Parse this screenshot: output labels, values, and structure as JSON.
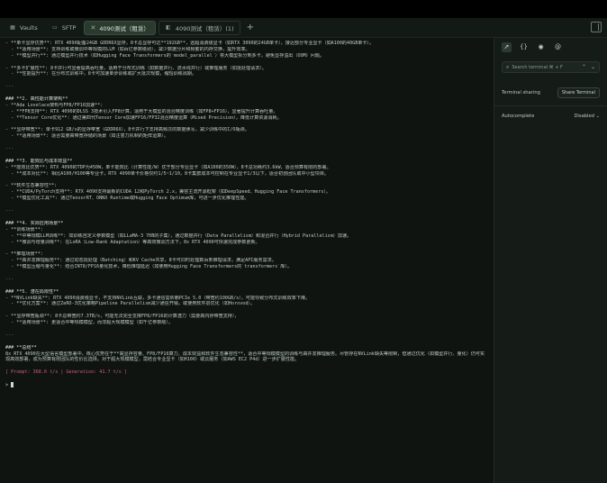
{
  "tabs": [
    {
      "label": "Vaults",
      "icon": "vault-icon"
    },
    {
      "label": "SFTP",
      "icon": "folder-icon"
    },
    {
      "label": "4090测试（租赁）",
      "icon": "close-icon",
      "active": true
    },
    {
      "label": "4090测试（租赁）(1)",
      "icon": "terminal-icon"
    }
  ],
  "terminal_lines": [
    "- **单卡显存优势**: RTX 4090配备24GB GDDR6X显存，8卡总显存可达**192GB**，远超消费级显卡（如RTX 3090的24GB单卡），接近部分专业显卡（如A100的40GB单卡）。",
    "  - **适用场景**: 支持训练或微调中等规模的LLM（如百亿参数级别），减少数据分片和频繁的内存交换，提升效率。",
    "  - **模型并行**: 通过模型并行技术（如Hugging Face Transformers的`model_parallel`）将大模型拆分到多卡，避免显存溢出（OOM）问题。",
    "",
    "- **多卡扩展性**: 8卡并行可显著提高吞吐量，适用于分布式训练（如数据并行、流水线并行）或推理服务（如批处理请求）。",
    "  - **性能提升**: 在分布式训练中，8卡可加速单步训练或扩大批次规模，缩短训练周期。",
    "",
    "---",
    "",
    "### **2. 高性能计算架构**",
    "- **Ada Lovelace架构与FP8/FP16加速**:",
    "  - **FP8支持**: RTX 4090的DLSS 3技术引入FP8计算，适用于大模型的混合精度训练（如FP8+FP16），显著提升计算吞吐量。",
    "  - **Tensor Core优化**: 通过第四代Tensor Core加速FP16/FP32混合精度运算（Mixed Precision），降低计算资源消耗。",
    "",
    "- **显存带宽**: 单卡912 GB/s的显存带宽（GDDR6X），8卡并行下支持高频次的数据读写，减少训练中的I/O瓶颈。",
    "  - **适用场景**: 适合需要高带宽存储的场景（如注意力机制的矩阵运算）。",
    "",
    "---",
    "",
    "### **3. 能效比与成本效益**",
    "- **能效比优势**: RTX 4090的TDP为450W，单卡能效比（计算性能/W）优于部分专业显卡（如A100的350W），8卡总功耗约3.6kW，适合预算有限的部署。",
    "  - **成本对比**: 相比A100/H100等专业卡，RTX 4090单卡价格仅约1/5~1/10，8卡集群成本可控制在专业显卡1/3以下，适合初创团队或中小型项目。",
    "",
    "- **软件生态兼容性**:",
    "  - **CUDA/PyTorch支持**: RTX 4090支持最新的CUDA 12和PyTorch 2.x，兼容主流开源框架（如DeepSpeed、Hugging Face Transformers）。",
    "  - **模型优化工具**: 通过TensorRT、ONNX Runtime或Hugging Face Optimum库，可进一步优化推理性能。",
    "",
    "---",
    "",
    "### **4. 实际应用场景**",
    "- **训练场景**:",
    "  - **中等规模LLM训练**: 如训练自定义参数模型（如LLaMA-3 70B的子集），通过数据并行（Data Parallelism）和混合并行（Hybrid Parallelism）加速。",
    "  - **微调与增量训练**: 在LoRA（Low-Rank Adaptation）等高效微调方法下，8x RTX 4090可快速完成参数更新。",
    "",
    "- **推理场景**:",
    "  - **高并发推理服务**: 通过动态批处理（Batching）和KV Cache共享，8卡可同时处理数百条推理请求，满足API服务需求。",
    "  - **模型压缩与量化**: 结合INT8/FP16量化技术，降低推理延迟（如使用Hugging Face Transformers的`transformers`库）。",
    "",
    "---",
    "",
    "### **5. 潜在局限性**",
    "- **NVLink缺失**: RTX 4090消费级显卡，不支持NVLink互联，多卡通信需依赖PCIe 5.0（带宽约100GB/s），可能导致分布式训练效率下降。",
    "  - **优化方案**: 通过ZeRO-3优化策略Pipeline Parallelism减少通信开销，或使用软件层优化（如Horovod）。",
    "",
    "- **显存带宽瓶颈**: 8卡总带宽约7.3TB/s，可能无法完全支撑FP8/FP16的计算潜力（需要高内存带宽支持），",
    "  - **适用场景**: 更适合中等规模模型，而非超大规模模型（如千亿参数级）。",
    "",
    "---",
    "",
    "### **总结**",
    "8x RTX 4090在大型语言模型部署中，核心优势在于**高显存容量、FP8/FP16算力、成本效益和软件生态兼容性**，适合中等规模模型的训练与高并发推理服务。尽管存在NVLink缺失等限制，但通过优化（如模型并行、量化）仍可实现高效部署，成为预算有限团队的性价比选择。对于超大规模模型，需结合专业显卡（如H100）或云服务（如AWS EC2 P4d）进一步扩展性能。",
    "",
    "[ Prompt: 368.0 t/s | Generation: 41.7 t/s ]",
    "",
    ">"
  ],
  "sidebar": {
    "search_placeholder": "Search terminal  ⌘ + F",
    "terminal_sharing_label": "Terminal sharing",
    "share_button": "Share Terminal",
    "autocomplete_label": "Autocomplete",
    "autocomplete_value": "Disabled"
  },
  "colors": {
    "background": "#0f1411",
    "status_pink": "#d05a76",
    "active_tab": "#2a3a2f"
  }
}
